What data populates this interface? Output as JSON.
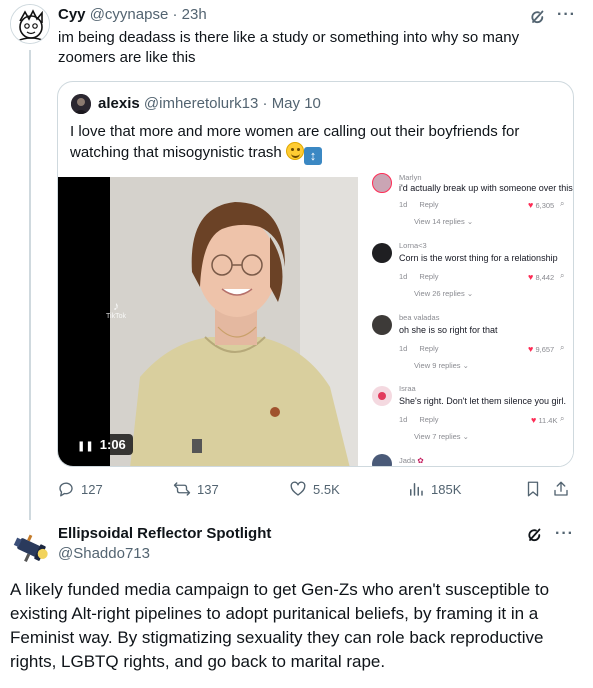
{
  "tweet1": {
    "display_name": "Cyy",
    "handle": "@cyynapse",
    "separator": "·",
    "time": "23h",
    "text": "im being deadass is there like a study or something into why so many zoomers are like this",
    "more": "···",
    "quote": {
      "display_name": "alexis",
      "handle": "@imheretolurk13",
      "separator": "·",
      "date": "May 10",
      "text": "I love that more and more women are calling out their boyfriends for watching  that misogynistic trash",
      "video_duration": "1:06",
      "tiktok_label": "TikTok",
      "comments": [
        {
          "user": "Marlyn",
          "text": "i'd actually break up with someone over this",
          "age": "1d",
          "reply": "Reply",
          "likes": "6,305",
          "view_replies": "View 14 replies"
        },
        {
          "user": "Lorna<3",
          "text": "Corn is the worst thing for a relationship",
          "age": "1d",
          "reply": "Reply",
          "likes": "8,442",
          "view_replies": "View 26 replies"
        },
        {
          "user": "bea valadas",
          "text": "oh she is so right for that",
          "age": "1d",
          "reply": "Reply",
          "likes": "9,657",
          "view_replies": "View 9 replies"
        },
        {
          "user": "Israa",
          "text": "She's right. Don't let them silence you girl.",
          "age": "1d",
          "reply": "Reply",
          "likes": "11.4K",
          "view_replies": "View 7 replies"
        },
        {
          "user": "Jada"
        }
      ]
    },
    "actions": {
      "replies": "127",
      "reposts": "137",
      "likes": "5.5K",
      "views": "185K"
    }
  },
  "tweet2": {
    "display_name": "Ellipsoidal Reflector Spotlight",
    "handle": "@Shaddo713",
    "more": "···",
    "text": "A likely funded media campaign to get Gen-Zs who aren't susceptible to existing Alt-right pipelines to adopt puritanical beliefs, by framing it in a Feminist way. By stigmatizing sexuality they can role back reproductive rights, LGBTQ rights, and go back to marital rape."
  }
}
